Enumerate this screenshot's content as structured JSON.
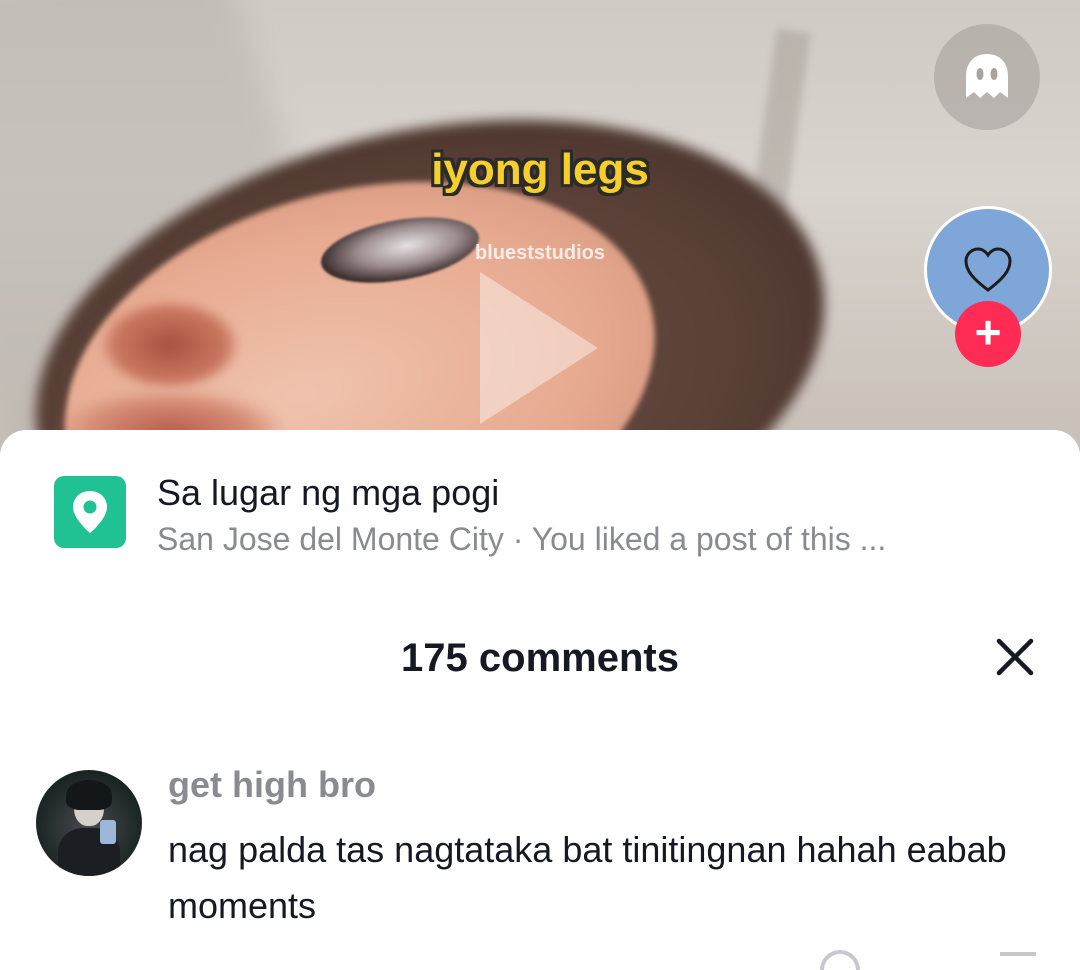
{
  "video": {
    "caption": "iyong legs",
    "watermark": "blueststudios"
  },
  "icons": {
    "ghost": "ghost-icon",
    "heart": "heart-icon",
    "plus": "plus-icon",
    "location": "location-pin-icon",
    "close": "close-icon"
  },
  "colors": {
    "follow_accent": "#fe2c55",
    "location_accent": "#20c193",
    "caption_yellow": "#f6cf2e"
  },
  "follow": {
    "plus_label": "+"
  },
  "location": {
    "title": "Sa lugar ng mga pogi",
    "subtitle": "San Jose del Monte City · You liked a post of this ..."
  },
  "comments": {
    "header": "175 comments",
    "items": [
      {
        "username": "get high bro",
        "text": "nag palda tas nagtataka bat tinitingnan hahah eabab moments"
      }
    ]
  }
}
